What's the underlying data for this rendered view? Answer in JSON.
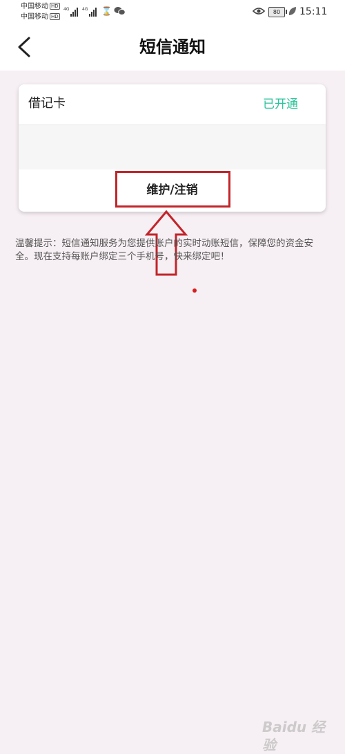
{
  "status_bar": {
    "carrier1": "中国移动",
    "carrier2": "中国移动",
    "hd": "HD",
    "network": "4G",
    "battery": "80",
    "time": "15:11"
  },
  "header": {
    "title": "短信通知"
  },
  "card": {
    "account_type": "借记卡",
    "status": "已开通",
    "action_label": "维护/注销"
  },
  "tip": {
    "text": "温馨提示：短信通知服务为您提供账户的实时动账短信，保障您的资金安全。现在支持每账户绑定三个手机号，快来绑定吧！"
  },
  "watermark": {
    "text": "Baidu 经验"
  },
  "colors": {
    "accent_green": "#2cc39a",
    "annotation_red": "#c2242a",
    "page_background": "#f6eff3"
  }
}
